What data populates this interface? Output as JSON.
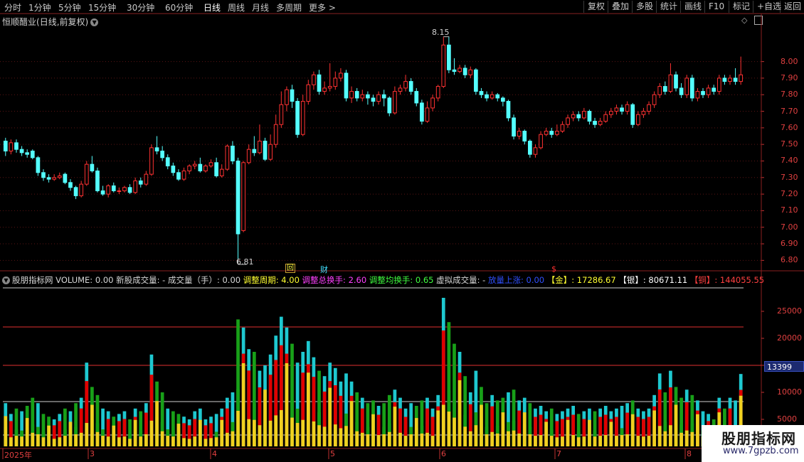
{
  "toolbar": {
    "periods": [
      "分时",
      "1分钟",
      "5分钟",
      "15分钟",
      "30分钟",
      "60分钟",
      "日线",
      "周线",
      "月线",
      "多周期",
      "更多 >"
    ],
    "active_period": "日线",
    "right_buttons": [
      "复权",
      "叠加",
      "多股",
      "统计",
      "画线",
      "F10",
      "标记",
      "+自选",
      "返回"
    ]
  },
  "chart_header": {
    "stock_name": "恒顺醋业",
    "mode": "(日线,前复权)",
    "mode_icon": "chevron-down-icon"
  },
  "price_axis": {
    "labels": [
      "8.00",
      "7.90",
      "7.80",
      "7.70",
      "7.60",
      "7.50",
      "7.40",
      "7.30",
      "7.20",
      "7.10",
      "7.00",
      "6.90",
      "6.80"
    ]
  },
  "annotations": {
    "high": "8.15",
    "low": "6.81",
    "marker_hui": "回",
    "marker_cai": "财",
    "marker_dollar": "$"
  },
  "indicator": {
    "name": "股朋指标网",
    "items": [
      {
        "text": "VOLUME: 0.00",
        "color": "#d8d8d8"
      },
      {
        "text": "新股成交量: -",
        "color": "#d8d8d8"
      },
      {
        "text": "成交量（手）: 0.00",
        "color": "#d8d8d8"
      },
      {
        "text": "调整周期: 4.00",
        "color": "#ffff30"
      },
      {
        "text": "调整总换手: 2.60",
        "color": "#ff40ff"
      },
      {
        "text": "调整均换手: 0.65",
        "color": "#40ff40"
      },
      {
        "text": "虚拟成交量: -",
        "color": "#d8d8d8"
      },
      {
        "text": "放量上涨: 0.00",
        "color": "#3050ff"
      },
      {
        "text": "【金】: 17286.67",
        "color": "#ffff30"
      },
      {
        "text": "【银】: 80671.11",
        "color": "#ffffff"
      },
      {
        "text": "【铜】: 144055.55",
        "color": "#ff4040"
      }
    ]
  },
  "volume_axis": {
    "labels": [
      "25000",
      "20000",
      "15000",
      "10000",
      "5000"
    ],
    "current_value": "13399"
  },
  "date_axis": {
    "labels": [
      "2025年",
      "3",
      "4",
      "5",
      "6",
      "7",
      "8"
    ]
  },
  "watermark": {
    "line1": "股朋指标网",
    "line2": "www.7gpzb.com"
  },
  "chart_data": {
    "type": "candlestick",
    "y_range": [
      6.75,
      8.2
    ],
    "volume_range": [
      0,
      30000
    ],
    "candles": [
      [
        7.52,
        7.46,
        7.54,
        7.43,
        8000
      ],
      [
        7.46,
        7.51,
        7.53,
        7.44,
        6000
      ],
      [
        7.51,
        7.47,
        7.53,
        7.45,
        7000
      ],
      [
        7.47,
        7.45,
        7.49,
        7.43,
        6500
      ],
      [
        7.45,
        7.44,
        7.47,
        7.42,
        7500
      ],
      [
        7.46,
        7.42,
        7.47,
        7.41,
        9000
      ],
      [
        7.42,
        7.33,
        7.43,
        7.31,
        8000
      ],
      [
        7.33,
        7.3,
        7.35,
        7.28,
        6000
      ],
      [
        7.3,
        7.29,
        7.32,
        7.27,
        5500
      ],
      [
        7.29,
        7.3,
        7.32,
        7.28,
        5000
      ],
      [
        7.3,
        7.31,
        7.33,
        7.29,
        6000
      ],
      [
        7.32,
        7.27,
        7.33,
        7.26,
        7000
      ],
      [
        7.27,
        7.24,
        7.29,
        7.22,
        6500
      ],
      [
        7.24,
        7.19,
        7.25,
        7.17,
        8000
      ],
      [
        7.19,
        7.26,
        7.28,
        7.18,
        9000
      ],
      [
        7.26,
        7.38,
        7.4,
        7.25,
        15500
      ],
      [
        7.38,
        7.34,
        7.43,
        7.33,
        11000
      ],
      [
        7.34,
        7.22,
        7.36,
        7.21,
        9500
      ],
      [
        7.22,
        7.2,
        7.25,
        7.19,
        7000
      ],
      [
        7.2,
        7.25,
        7.26,
        7.18,
        6500
      ],
      [
        7.25,
        7.22,
        7.27,
        7.21,
        5500
      ],
      [
        7.22,
        7.22,
        7.24,
        7.2,
        6000
      ],
      [
        7.22,
        7.24,
        7.25,
        7.21,
        6500
      ],
      [
        7.24,
        7.21,
        7.26,
        7.2,
        5000
      ],
      [
        7.21,
        7.28,
        7.3,
        7.2,
        7000
      ],
      [
        7.28,
        7.26,
        7.3,
        7.24,
        6500
      ],
      [
        7.26,
        7.32,
        7.34,
        7.25,
        8000
      ],
      [
        7.32,
        7.48,
        7.5,
        7.31,
        17000
      ],
      [
        7.48,
        7.46,
        7.55,
        7.44,
        12000
      ],
      [
        7.46,
        7.42,
        7.49,
        7.4,
        10000
      ],
      [
        7.42,
        7.37,
        7.44,
        7.35,
        7000
      ],
      [
        7.37,
        7.33,
        7.39,
        7.31,
        6500
      ],
      [
        7.33,
        7.29,
        7.35,
        7.28,
        6000
      ],
      [
        7.29,
        7.34,
        7.36,
        7.28,
        5500
      ],
      [
        7.34,
        7.37,
        7.38,
        7.32,
        5000
      ],
      [
        7.37,
        7.38,
        7.4,
        7.35,
        6500
      ],
      [
        7.38,
        7.34,
        7.42,
        7.33,
        7000
      ],
      [
        7.34,
        7.37,
        7.38,
        7.33,
        5000
      ],
      [
        7.37,
        7.39,
        7.41,
        7.36,
        5500
      ],
      [
        7.39,
        7.31,
        7.42,
        7.3,
        6000
      ],
      [
        7.31,
        7.35,
        7.38,
        7.3,
        7000
      ],
      [
        7.35,
        7.49,
        7.5,
        7.34,
        9000
      ],
      [
        7.49,
        7.4,
        7.52,
        7.38,
        10000
      ],
      [
        7.4,
        6.96,
        7.42,
        6.81,
        23500
      ],
      [
        6.98,
        7.39,
        7.4,
        6.97,
        22000
      ],
      [
        7.39,
        7.47,
        7.5,
        7.38,
        18000
      ],
      [
        7.47,
        7.45,
        7.55,
        7.43,
        17500
      ],
      [
        7.45,
        7.52,
        7.62,
        7.44,
        14000
      ],
      [
        7.52,
        7.41,
        7.54,
        7.4,
        15000
      ],
      [
        7.41,
        7.5,
        7.56,
        7.4,
        17000
      ],
      [
        7.5,
        7.62,
        7.68,
        7.48,
        20500
      ],
      [
        7.62,
        7.74,
        7.82,
        7.6,
        24000
      ],
      [
        7.74,
        7.83,
        7.85,
        7.7,
        22000
      ],
      [
        7.83,
        7.76,
        7.86,
        7.72,
        19000
      ],
      [
        7.76,
        7.56,
        7.78,
        7.54,
        15500
      ],
      [
        7.56,
        7.76,
        7.8,
        7.55,
        17500
      ],
      [
        7.76,
        7.86,
        7.89,
        7.74,
        19500
      ],
      [
        7.86,
        7.92,
        7.94,
        7.83,
        16500
      ],
      [
        7.92,
        7.82,
        7.95,
        7.8,
        14000
      ],
      [
        7.82,
        7.84,
        7.88,
        7.8,
        13000
      ],
      [
        7.84,
        7.85,
        7.99,
        7.82,
        15500
      ],
      [
        7.85,
        7.9,
        7.94,
        7.83,
        14500
      ],
      [
        7.9,
        7.93,
        7.96,
        7.88,
        12000
      ],
      [
        7.93,
        7.78,
        7.95,
        7.76,
        13500
      ],
      [
        7.78,
        7.82,
        7.85,
        7.75,
        12000
      ],
      [
        7.82,
        7.78,
        7.84,
        7.76,
        10000
      ],
      [
        7.78,
        7.8,
        7.83,
        7.76,
        9000
      ],
      [
        7.8,
        7.78,
        7.82,
        7.74,
        8000
      ],
      [
        7.78,
        7.76,
        7.8,
        7.73,
        8500
      ],
      [
        7.76,
        7.8,
        7.82,
        7.74,
        7500
      ],
      [
        7.8,
        7.78,
        7.83,
        7.73,
        8000
      ],
      [
        7.78,
        7.69,
        7.79,
        7.67,
        9500
      ],
      [
        7.69,
        7.82,
        7.85,
        7.68,
        10500
      ],
      [
        7.82,
        7.84,
        7.86,
        7.8,
        9000
      ],
      [
        7.84,
        7.88,
        7.92,
        7.82,
        7000
      ],
      [
        7.88,
        7.82,
        7.9,
        7.8,
        8000
      ],
      [
        7.82,
        7.75,
        7.84,
        7.73,
        7500
      ],
      [
        7.75,
        7.64,
        7.77,
        7.62,
        8500
      ],
      [
        7.64,
        7.72,
        7.76,
        7.63,
        9000
      ],
      [
        7.72,
        7.78,
        7.8,
        7.7,
        7000
      ],
      [
        7.78,
        7.85,
        7.86,
        7.76,
        9500
      ],
      [
        7.85,
        8.1,
        8.15,
        7.84,
        27500
      ],
      [
        8.1,
        7.95,
        8.15,
        7.93,
        23000
      ],
      [
        7.95,
        7.94,
        8.02,
        7.92,
        19000
      ],
      [
        7.94,
        7.96,
        7.98,
        7.93,
        17500
      ],
      [
        7.96,
        7.92,
        7.98,
        7.9,
        13000
      ],
      [
        7.92,
        7.95,
        7.97,
        7.9,
        10000
      ],
      [
        7.95,
        7.82,
        7.96,
        7.8,
        14000
      ],
      [
        7.82,
        7.8,
        7.84,
        7.78,
        11000
      ],
      [
        7.8,
        7.78,
        7.82,
        7.76,
        8000
      ],
      [
        7.78,
        7.8,
        7.82,
        7.77,
        9500
      ],
      [
        7.8,
        7.78,
        7.81,
        7.76,
        8500
      ],
      [
        7.78,
        7.76,
        7.79,
        7.73,
        9000
      ],
      [
        7.76,
        7.66,
        7.77,
        7.64,
        10000
      ],
      [
        7.66,
        7.55,
        7.68,
        7.53,
        10500
      ],
      [
        7.55,
        7.58,
        7.6,
        7.53,
        8500
      ],
      [
        7.58,
        7.52,
        7.59,
        7.5,
        9000
      ],
      [
        7.52,
        7.44,
        7.53,
        7.42,
        8000
      ],
      [
        7.44,
        7.48,
        7.5,
        7.42,
        7000
      ],
      [
        7.48,
        7.56,
        7.58,
        7.47,
        7500
      ],
      [
        7.56,
        7.58,
        7.6,
        7.55,
        6500
      ],
      [
        7.58,
        7.56,
        7.6,
        7.54,
        7000
      ],
      [
        7.56,
        7.58,
        7.62,
        7.55,
        6000
      ],
      [
        7.58,
        7.62,
        7.64,
        7.57,
        6500
      ],
      [
        7.62,
        7.66,
        7.68,
        7.6,
        7000
      ],
      [
        7.66,
        7.68,
        7.7,
        7.64,
        7500
      ],
      [
        7.68,
        7.66,
        7.7,
        7.64,
        6000
      ],
      [
        7.66,
        7.7,
        7.72,
        7.65,
        6500
      ],
      [
        7.7,
        7.64,
        7.71,
        7.62,
        7000
      ],
      [
        7.64,
        7.62,
        7.66,
        7.6,
        6500
      ],
      [
        7.62,
        7.64,
        7.66,
        7.61,
        7000
      ],
      [
        7.64,
        7.68,
        7.7,
        7.63,
        7500
      ],
      [
        7.68,
        7.7,
        7.72,
        7.66,
        6500
      ],
      [
        7.7,
        7.72,
        7.74,
        7.68,
        7000
      ],
      [
        7.72,
        7.7,
        7.74,
        7.68,
        7500
      ],
      [
        7.7,
        7.74,
        7.76,
        7.68,
        8000
      ],
      [
        7.74,
        7.62,
        7.75,
        7.6,
        8500
      ],
      [
        7.62,
        7.68,
        7.7,
        7.61,
        7000
      ],
      [
        7.68,
        7.7,
        7.72,
        7.66,
        6500
      ],
      [
        7.7,
        7.74,
        7.76,
        7.68,
        7000
      ],
      [
        7.74,
        7.8,
        7.82,
        7.72,
        9500
      ],
      [
        7.8,
        7.85,
        7.87,
        7.78,
        13500
      ],
      [
        7.85,
        7.82,
        7.88,
        7.8,
        10000
      ],
      [
        7.82,
        7.92,
        7.99,
        7.81,
        14000
      ],
      [
        7.92,
        7.84,
        7.94,
        7.82,
        11000
      ],
      [
        7.84,
        7.8,
        7.87,
        7.78,
        9000
      ],
      [
        7.8,
        7.9,
        7.92,
        7.78,
        10500
      ],
      [
        7.9,
        7.78,
        7.92,
        7.76,
        9500
      ],
      [
        7.78,
        7.82,
        7.84,
        7.76,
        8500
      ],
      [
        7.82,
        7.8,
        7.84,
        7.78,
        6500
      ],
      [
        7.8,
        7.84,
        7.86,
        7.78,
        6000
      ],
      [
        7.84,
        7.82,
        7.86,
        7.8,
        5000
      ],
      [
        7.82,
        7.9,
        7.92,
        7.8,
        9000
      ],
      [
        7.9,
        7.88,
        7.92,
        7.86,
        7000
      ],
      [
        7.88,
        7.9,
        7.92,
        7.86,
        9000
      ],
      [
        7.9,
        7.88,
        7.96,
        7.86,
        8500
      ],
      [
        7.88,
        7.92,
        8.03,
        7.86,
        13400
      ]
    ]
  }
}
